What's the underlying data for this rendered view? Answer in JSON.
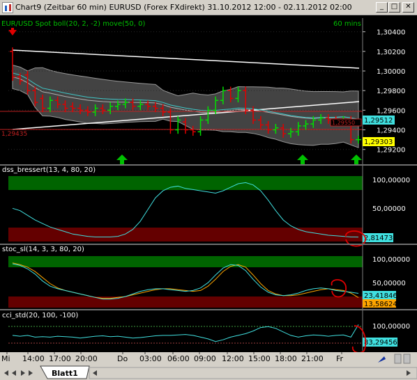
{
  "window": {
    "title": "Chart9 (Zeitbar 60 min)  EURUSD (Forex FXdirekt) 31.10.2012 12:00 - 02.11.2012 02:00",
    "minimize": "_",
    "maximize": "□",
    "close": "✕"
  },
  "main_panel": {
    "legend": "EUR/USD Spot  boll(20, 2, -2) move(50, 0)",
    "timeframe": "60 mins",
    "y_ticks": [
      "1,30400",
      "1,30200",
      "1,30000",
      "1,29800",
      "1,29600",
      "1,29400",
      "1,29200"
    ],
    "level_label": "1,29435",
    "price_tag_cyan": "1,29512",
    "price_tag_yellow": "1,29303",
    "price_tag_red": "1,29550"
  },
  "dss_panel": {
    "legend": "dss_bressert(13, 4, 80, 20)",
    "y_ticks": [
      "100,00000",
      "50,00000"
    ],
    "value_tag": "2,81473"
  },
  "stoc_panel": {
    "legend": "stoc_sl(14, 3, 3, 80, 20)",
    "y_ticks": [
      "100,00000",
      "50,00000"
    ],
    "value_tag_cyan": "23,41846",
    "value_tag_orange": "13,58624"
  },
  "cci_panel": {
    "legend": "cci_std(20, 100, -100)",
    "y_ticks": [
      "100,00000"
    ],
    "value_tag": "83,29456"
  },
  "x_axis": {
    "labels": [
      "Mi",
      "14:00",
      "17:00",
      "20:00",
      "Do",
      "03:00",
      "06:00",
      "09:00",
      "12:00",
      "15:00",
      "18:00",
      "21:00",
      "Fr"
    ]
  },
  "sheet_tab": "Blatt1",
  "colors": {
    "up_candle": "#00e000",
    "down_candle": "#e00000",
    "bollinger_band": "#808080",
    "overbought_zone": "#006400",
    "oversold_zone": "#640000",
    "indicator_line": "#40e0e0",
    "signal_line": "#ffa500",
    "annotation_circle": "#e00000"
  },
  "chart_data": {
    "type": "candlestick",
    "symbol": "EUR/USD Spot",
    "x_range": [
      "31.10.2012 12:00",
      "02.11.2012 02:00"
    ],
    "ylim": [
      1.2912,
      1.3044
    ],
    "candles": [
      {
        "o": 1.302,
        "c": 1.2994
      },
      {
        "o": 1.2994,
        "c": 1.299
      },
      {
        "o": 1.2996,
        "c": 1.298
      },
      {
        "o": 1.298,
        "c": 1.2968
      },
      {
        "o": 1.2972,
        "c": 1.2962
      },
      {
        "o": 1.2962,
        "c": 1.297
      },
      {
        "o": 1.297,
        "c": 1.2966
      },
      {
        "o": 1.2966,
        "c": 1.2962
      },
      {
        "o": 1.2964,
        "c": 1.2962
      },
      {
        "o": 1.2962,
        "c": 1.296
      },
      {
        "o": 1.296,
        "c": 1.2958
      },
      {
        "o": 1.2958,
        "c": 1.2962
      },
      {
        "o": 1.2962,
        "c": 1.296
      },
      {
        "o": 1.296,
        "c": 1.2964
      },
      {
        "o": 1.2964,
        "c": 1.2966
      },
      {
        "o": 1.2966,
        "c": 1.2968
      },
      {
        "o": 1.2968,
        "c": 1.2964
      },
      {
        "o": 1.2964,
        "c": 1.2966
      },
      {
        "o": 1.2966,
        "c": 1.2964
      },
      {
        "o": 1.2964,
        "c": 1.2962
      },
      {
        "o": 1.2962,
        "c": 1.2958
      },
      {
        "o": 1.2958,
        "c": 1.294
      },
      {
        "o": 1.294,
        "c": 1.295
      },
      {
        "o": 1.2948,
        "c": 1.294
      },
      {
        "o": 1.294,
        "c": 1.2938
      },
      {
        "o": 1.2938,
        "c": 1.295
      },
      {
        "o": 1.295,
        "c": 1.296
      },
      {
        "o": 1.296,
        "c": 1.297
      },
      {
        "o": 1.297,
        "c": 1.298
      },
      {
        "o": 1.298,
        "c": 1.2972
      },
      {
        "o": 1.2972,
        "c": 1.298
      },
      {
        "o": 1.298,
        "c": 1.296
      },
      {
        "o": 1.296,
        "c": 1.295
      },
      {
        "o": 1.295,
        "c": 1.2945
      },
      {
        "o": 1.2945,
        "c": 1.294
      },
      {
        "o": 1.294,
        "c": 1.2942
      },
      {
        "o": 1.2942,
        "c": 1.2936
      },
      {
        "o": 1.2936,
        "c": 1.2938
      },
      {
        "o": 1.2938,
        "c": 1.2944
      },
      {
        "o": 1.2944,
        "c": 1.2946
      },
      {
        "o": 1.2946,
        "c": 1.295
      },
      {
        "o": 1.295,
        "c": 1.2952
      },
      {
        "o": 1.2952,
        "c": 1.295
      },
      {
        "o": 1.295,
        "c": 1.2948
      },
      {
        "o": 1.2948,
        "c": 1.295
      },
      {
        "o": 1.295,
        "c": 1.293
      },
      {
        "o": 1.293,
        "c": 1.293
      }
    ],
    "dss": [
      52,
      48,
      40,
      32,
      26,
      20,
      16,
      12,
      8,
      6,
      4,
      3,
      3,
      3,
      4,
      8,
      16,
      30,
      50,
      70,
      82,
      88,
      90,
      86,
      84,
      82,
      80,
      78,
      82,
      88,
      94,
      96,
      92,
      82,
      66,
      48,
      32,
      22,
      16,
      12,
      10,
      8,
      6,
      5,
      4,
      3,
      2.8
    ],
    "stoc_k": [
      92,
      88,
      80,
      68,
      52,
      40,
      34,
      30,
      26,
      22,
      18,
      14,
      10,
      10,
      12,
      16,
      22,
      28,
      32,
      34,
      34,
      32,
      30,
      28,
      30,
      36,
      48,
      66,
      82,
      90,
      88,
      76,
      56,
      38,
      26,
      20,
      18,
      20,
      24,
      30,
      34,
      36,
      34,
      30,
      28,
      26,
      23.4
    ],
    "stoc_d": [
      94,
      90,
      84,
      74,
      60,
      46,
      36,
      30,
      26,
      22,
      18,
      14,
      12,
      12,
      14,
      16,
      20,
      24,
      28,
      32,
      34,
      34,
      32,
      30,
      28,
      30,
      40,
      56,
      74,
      86,
      90,
      84,
      66,
      46,
      30,
      22,
      18,
      18,
      20,
      24,
      28,
      32,
      34,
      32,
      30,
      24,
      13.6
    ],
    "cci": [
      -40,
      -50,
      -40,
      -60,
      -55,
      -60,
      -50,
      -55,
      -60,
      -70,
      -60,
      -50,
      -45,
      -55,
      -50,
      -60,
      -70,
      -65,
      -55,
      -45,
      -40,
      -40,
      -35,
      -30,
      -40,
      -60,
      -80,
      -110,
      -90,
      -60,
      -40,
      -20,
      10,
      50,
      60,
      40,
      0,
      -40,
      -60,
      -45,
      -35,
      -40,
      -50,
      -40,
      -35,
      -60,
      83.3
    ]
  }
}
